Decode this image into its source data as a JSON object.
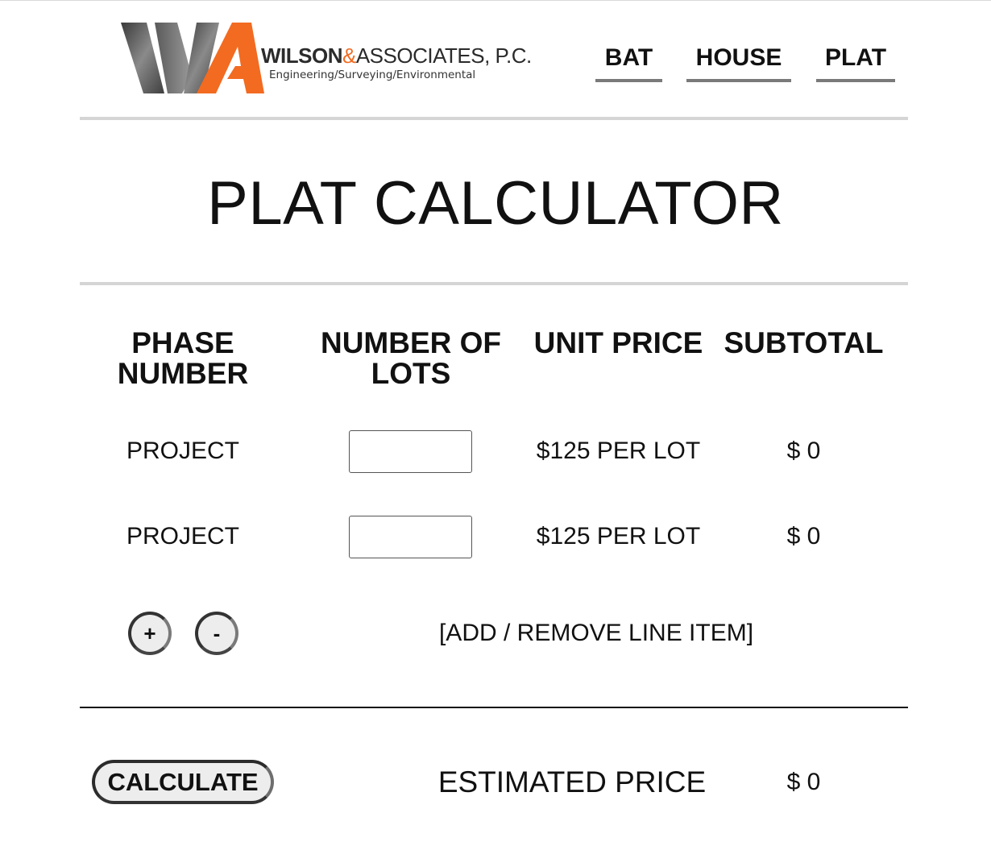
{
  "brand": {
    "name_bold": "WILSON",
    "name_amp": "&",
    "name_rest": "ASSOCIATES, P.C.",
    "tagline": "Engineering/Surveying/Environmental",
    "accent_color": "#f26b21",
    "dark_color": "#4a4a4a"
  },
  "nav": {
    "items": [
      {
        "label": "BAT"
      },
      {
        "label": "HOUSE"
      },
      {
        "label": "PLAT"
      }
    ]
  },
  "page": {
    "title": "PLAT CALCULATOR"
  },
  "table": {
    "headers": {
      "phase": "PHASE NUMBER",
      "lots": "NUMBER OF LOTS",
      "unit_price": "UNIT PRICE",
      "subtotal": "SUBTOTAL"
    },
    "rows": [
      {
        "phase": "PROJECT",
        "lots_value": "",
        "unit_price": "$125 PER LOT",
        "subtotal": "$ 0"
      },
      {
        "phase": "PROJECT",
        "lots_value": "",
        "unit_price": "$125 PER LOT",
        "subtotal": "$ 0"
      }
    ]
  },
  "line_items": {
    "add_label": "+",
    "remove_label": "-",
    "hint": "[ADD / REMOVE LINE ITEM]"
  },
  "summary": {
    "calculate_label": "CALCULATE",
    "estimated_label": "ESTIMATED PRICE",
    "estimated_value": "$ 0"
  }
}
